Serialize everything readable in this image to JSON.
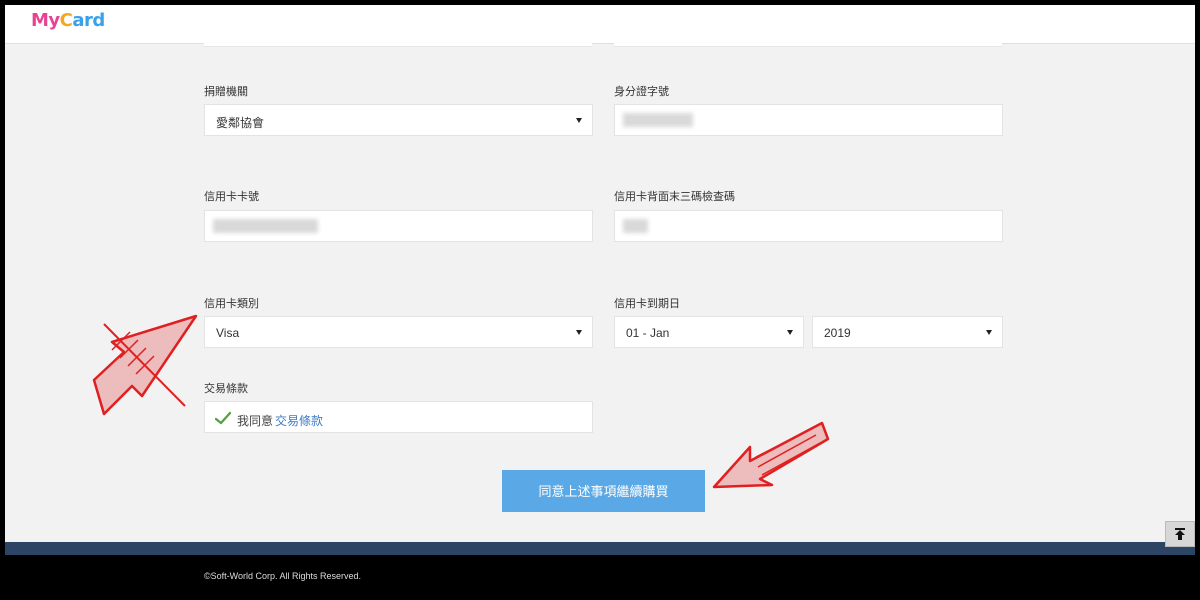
{
  "header": {
    "logo_part1": "My",
    "logo_part2": "C",
    "logo_part3": "ard"
  },
  "form": {
    "donation_org": {
      "label": "捐贈機關",
      "value": "愛鄰協會"
    },
    "id_number": {
      "label": "身分證字號"
    },
    "card_number": {
      "label": "信用卡卡號"
    },
    "cvv": {
      "label": "信用卡背面末三碼檢查碼"
    },
    "card_type": {
      "label": "信用卡類別",
      "value": "Visa"
    },
    "expiry": {
      "label": "信用卡到期日",
      "month": "01 - Jan",
      "year": "2019"
    },
    "terms": {
      "label": "交易條款",
      "agree_text": "我同意",
      "link_text": "交易條款"
    }
  },
  "submit": {
    "label": "同意上述事項繼續購買"
  },
  "footer": {
    "copyright": "©Soft-World Corp. All Rights Reserved."
  },
  "colors": {
    "primary_button": "#5aa9e6",
    "footer_band": "#2d4565",
    "annotation_arrow": "#e02020",
    "check": "#5aa048"
  },
  "icons": {
    "check": "check-icon",
    "back_to_top": "back-to-top-icon",
    "dropdown": "caret-down-icon"
  }
}
